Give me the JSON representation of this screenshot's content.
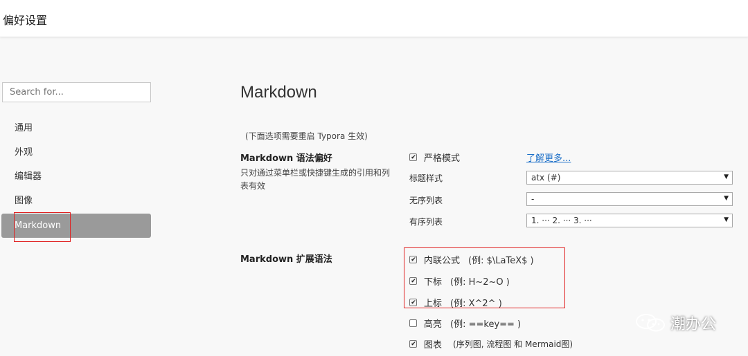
{
  "window": {
    "title": "偏好设置"
  },
  "search": {
    "placeholder": "Search for..."
  },
  "sidebar": {
    "items": [
      {
        "label": "通用"
      },
      {
        "label": "外观"
      },
      {
        "label": "编辑器"
      },
      {
        "label": "图像"
      },
      {
        "label": "Markdown",
        "active": true
      }
    ]
  },
  "main": {
    "heading": "Markdown",
    "restart_note": "(下面选项需要重启 Typora 生效)",
    "syntax_pref": {
      "title": "Markdown 语法偏好",
      "description": "只对通过菜单栏或快捷键生成的引用和列表有效",
      "strict_mode": {
        "label": "严格模式",
        "checked": true
      },
      "learn_more": "了解更多...",
      "heading_style": {
        "label": "标题样式",
        "value": "atx (#)"
      },
      "unordered_list": {
        "label": "无序列表",
        "value": "-"
      },
      "ordered_list": {
        "label": "有序列表",
        "value": "1. ··· 2. ··· 3. ···"
      }
    },
    "extended_syntax": {
      "title": "Markdown 扩展语法",
      "options": [
        {
          "label": "内联公式",
          "example": "(例:  $\\LaTeX$ )",
          "checked": true
        },
        {
          "label": "下标",
          "example": "(例:  H~2~O )",
          "checked": true
        },
        {
          "label": "上标",
          "example": "(例:  X^2^ )",
          "checked": true
        },
        {
          "label": "高亮",
          "example": "(例:  ==key== )",
          "checked": false
        },
        {
          "label": "图表",
          "example": "(序列图, 流程图 和 Mermaid图)",
          "checked": true
        }
      ]
    }
  },
  "watermark": {
    "text": "潮办公"
  },
  "colors": {
    "highlight_box": "#e02020",
    "link": "#1a6ec8",
    "active_nav": "#9a9a9a"
  }
}
